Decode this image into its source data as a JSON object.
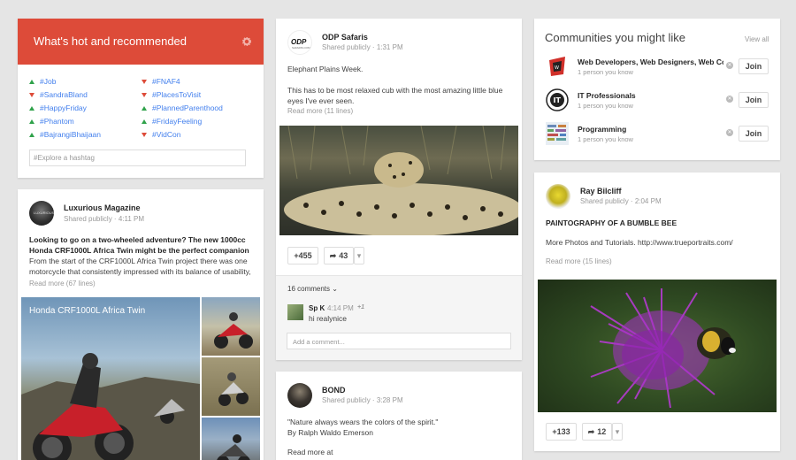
{
  "hot": {
    "title": "What's hot and recommended",
    "left_tags": [
      {
        "tag": "#Job",
        "trend": "up"
      },
      {
        "tag": "#SandraBland",
        "trend": "down"
      },
      {
        "tag": "#HappyFriday",
        "trend": "up"
      },
      {
        "tag": "#Phantom",
        "trend": "up"
      },
      {
        "tag": "#BajrangiBhaijaan",
        "trend": "up"
      }
    ],
    "right_tags": [
      {
        "tag": "#FNAF4",
        "trend": "down"
      },
      {
        "tag": "#PlacesToVisit",
        "trend": "down"
      },
      {
        "tag": "#PlannedParenthood",
        "trend": "up"
      },
      {
        "tag": "#FridayFeeling",
        "trend": "up"
      },
      {
        "tag": "#VidCon",
        "trend": "down"
      }
    ],
    "hashtag_placeholder": "Explore a hashtag"
  },
  "post_luxurious": {
    "author": "Luxurious Magazine",
    "visibility": "Shared publicly",
    "time": "4:11 PM",
    "headline": "Looking to go on a two-wheeled adventure? The new 1000cc Honda CRF1000L Africa Twin might be the perfect companion",
    "body": "From the start of the CRF1000L Africa Twin project there was one motorcycle that consistently impressed with its balance of usability,",
    "read_more": "Read more (67 lines)",
    "image_caption": "Honda CRF1000L Africa Twin"
  },
  "post_odp": {
    "author": "ODP Safaris",
    "visibility": "Shared publicly",
    "time": "1:31 PM",
    "title": "Elephant Plains Week.",
    "body": "This has to be most relaxed cub with the most amazing little blue eyes I've ever seen.",
    "read_more": "Read more (11 lines)",
    "plus_count": "+455",
    "share_count": "43",
    "comments_label": "16 comments",
    "comment_author": "Sp K",
    "comment_time": "4:14 PM",
    "comment_plus": "+1",
    "comment_text": "hi realynice",
    "add_comment_placeholder": "Add a comment..."
  },
  "post_bond": {
    "author": "BOND",
    "visibility": "Shared publicly",
    "time": "3:28 PM",
    "quote": "\"Nature always wears the colors of the spirit.\"",
    "quote_author": "By Ralph Waldo Emerson",
    "read_more": "Read more at"
  },
  "communities": {
    "title": "Communities you might like",
    "view_all": "View all",
    "items": [
      {
        "name": "Web Developers, Web Designers, Web Co",
        "sub": "1 person you know",
        "join": "Join"
      },
      {
        "name": "IT Professionals",
        "sub": "1 person you know",
        "join": "Join"
      },
      {
        "name": "Programming",
        "sub": "1 person you know",
        "join": "Join"
      }
    ]
  },
  "post_ray": {
    "author": "Ray Bilcliff",
    "visibility": "Shared publicly",
    "time": "2:04 PM",
    "title": "PAINTOGRAPHY OF A BUMBLE BEE",
    "body": "More Photos and Tutorials. http://www.trueportraits.com/",
    "read_more": "Read more (15 lines)",
    "plus_count": "+133",
    "share_count": "12"
  },
  "colors": {
    "accent_red": "#dd4b39",
    "link_blue": "#427fed",
    "trend_up": "#2fa24a"
  }
}
